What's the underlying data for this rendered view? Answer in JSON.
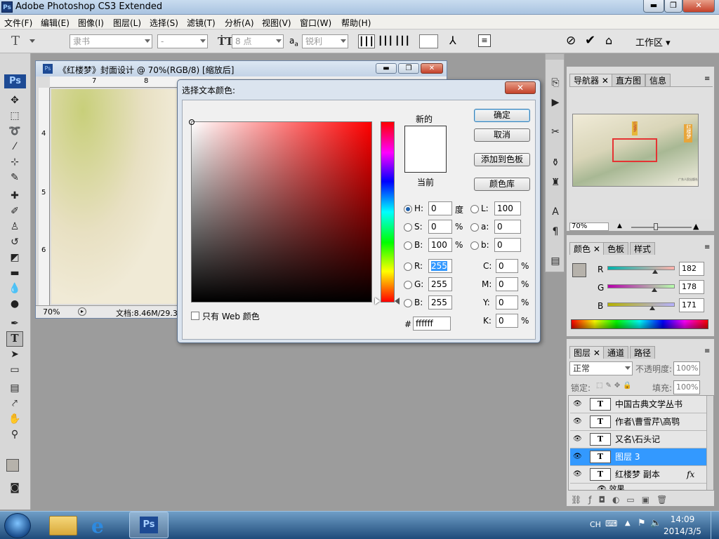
{
  "window": {
    "title": "Adobe Photoshop CS3 Extended",
    "ps_badge": "Ps",
    "min": "▬",
    "max": "❐",
    "close": "✕"
  },
  "menubar": [
    "文件(F)",
    "编辑(E)",
    "图像(I)",
    "图层(L)",
    "选择(S)",
    "滤镜(T)",
    "分析(A)",
    "视图(V)",
    "窗口(W)",
    "帮助(H)"
  ],
  "options": {
    "font_family": "隶书",
    "font_style": "-",
    "font_size": "8 点",
    "aa_label": "a",
    "aa_label2": "a",
    "antialias": "锐利",
    "workspace": "工作区",
    "tool_glyph": "T"
  },
  "doc": {
    "title": "《红楼梦》封面设计 @ 70%(RGB/8) [缩放后]",
    "ruler_top": [
      "7",
      "8"
    ],
    "ruler_left": [
      "4",
      "5",
      "6"
    ],
    "zoom": "70%",
    "docinfo": "文档:8.46M/29.3"
  },
  "dialog": {
    "title": "选择文本颜色:",
    "new_label": "新的",
    "current_label": "当前",
    "ok": "确定",
    "cancel": "取消",
    "add_swatch": "添加到色板",
    "color_library": "颜色库",
    "web_only": "只有 Web 颜色",
    "hsb": [
      {
        "label": "H:",
        "value": "0",
        "unit": "度"
      },
      {
        "label": "S:",
        "value": "0",
        "unit": "%"
      },
      {
        "label": "B:",
        "value": "100",
        "unit": "%"
      }
    ],
    "rgb": [
      {
        "label": "R:",
        "value": "255"
      },
      {
        "label": "G:",
        "value": "255"
      },
      {
        "label": "B:",
        "value": "255"
      }
    ],
    "lab": [
      {
        "label": "L:",
        "value": "100"
      },
      {
        "label": "a:",
        "value": "0"
      },
      {
        "label": "b:",
        "value": "0"
      }
    ],
    "cmyk": [
      {
        "label": "C:",
        "value": "0",
        "unit": "%"
      },
      {
        "label": "M:",
        "value": "0",
        "unit": "%"
      },
      {
        "label": "Y:",
        "value": "0",
        "unit": "%"
      },
      {
        "label": "K:",
        "value": "0",
        "unit": "%"
      }
    ],
    "hash": "#",
    "hex": "ffffff",
    "new_color": "#ffffff",
    "current_color": "#ffffff"
  },
  "navigator": {
    "tabs": [
      "导航器",
      "直方图",
      "信息"
    ],
    "zoom": "70%",
    "seal_text": "红楼梦",
    "publisher": "广东人民出版社"
  },
  "color_panel": {
    "tabs": [
      "颜色",
      "色板",
      "样式"
    ],
    "channels": [
      {
        "label": "R",
        "value": "182",
        "level": 0.714
      },
      {
        "label": "G",
        "value": "178",
        "level": 0.698
      },
      {
        "label": "B",
        "value": "171",
        "level": 0.671
      }
    ],
    "foreground": "#b6b2ab"
  },
  "layers": {
    "tabs": [
      "图层",
      "通道",
      "路径"
    ],
    "blend_mode": "正常",
    "opacity_label": "不透明度:",
    "opacity": "100%",
    "lock_label": "锁定:",
    "fill_label": "填充:",
    "fill": "100%",
    "thumb_glyph": "T",
    "effects_label": "效果",
    "fx": "fx",
    "items": [
      {
        "name": "中国古典文学丛书",
        "selected": false
      },
      {
        "name": "作者\\曹雪芹\\高鹗",
        "selected": false
      },
      {
        "name": "又名\\石头记",
        "selected": false
      },
      {
        "name": "图层 3",
        "selected": true
      },
      {
        "name": "红楼梦 副本",
        "selected": false
      }
    ]
  },
  "taskbar": {
    "lang": "CH",
    "time": "14:09",
    "date": "2014/3/5",
    "ps_label": "Ps"
  },
  "colors": {
    "accent": "#3399ff",
    "dialog_bg": "#dbe4ef"
  }
}
